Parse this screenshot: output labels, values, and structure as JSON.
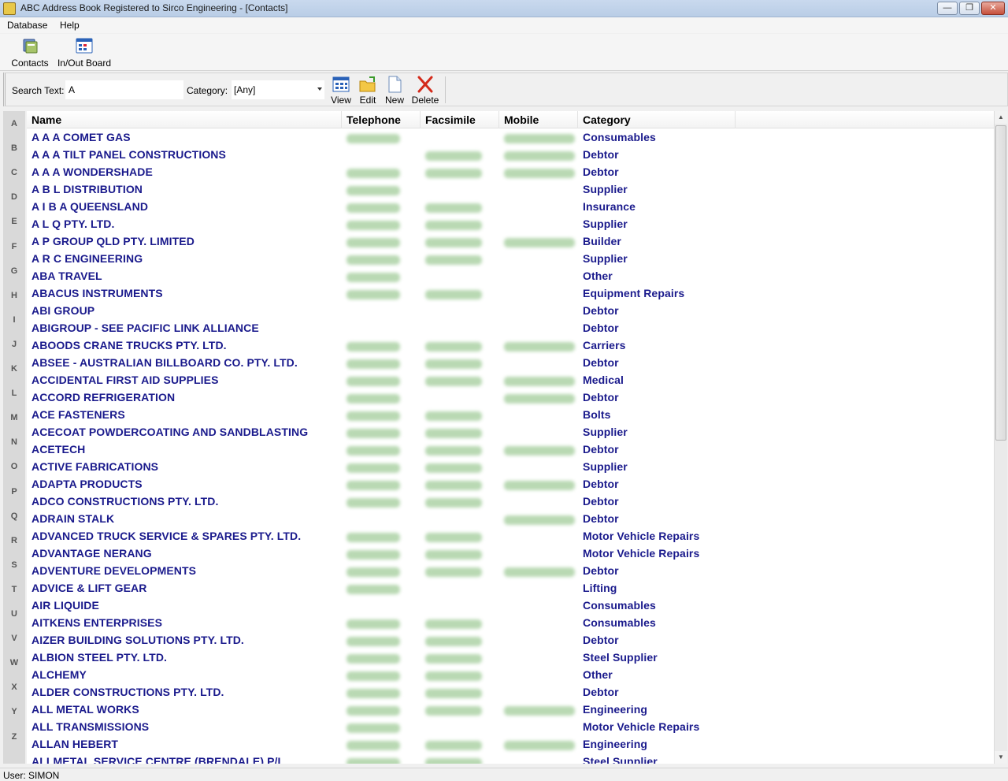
{
  "window": {
    "title": "ABC Address Book  Registered to Sirco Engineering - [Contacts]",
    "minimize_glyph": "—",
    "restore_glyph": "❐",
    "close_glyph": "✕"
  },
  "menu": {
    "items": [
      "Database",
      "Help"
    ]
  },
  "toolbar": {
    "contacts_label": "Contacts",
    "inout_label": "In/Out Board"
  },
  "search": {
    "search_label": "Search Text:",
    "search_value": "A",
    "category_label": "Category:",
    "category_value": "[Any]",
    "view_label": "View",
    "edit_label": "Edit",
    "new_label": "New",
    "delete_label": "Delete"
  },
  "alphabet": [
    "A",
    "B",
    "C",
    "D",
    "E",
    "F",
    "G",
    "H",
    "I",
    "J",
    "K",
    "L",
    "M",
    "N",
    "O",
    "P",
    "Q",
    "R",
    "S",
    "T",
    "U",
    "V",
    "W",
    "X",
    "Y",
    "Z"
  ],
  "table": {
    "columns": [
      "Name",
      "Telephone",
      "Facsimile",
      "Mobile",
      "Category"
    ],
    "rows": [
      {
        "name": "A A A COMET GAS",
        "category": "Consumables",
        "tel": 1,
        "fax": 0,
        "mob": 1
      },
      {
        "name": "A A A TILT PANEL CONSTRUCTIONS",
        "category": "Debtor",
        "tel": 0,
        "fax": 1,
        "mob": 1
      },
      {
        "name": "A A A WONDERSHADE",
        "category": "Debtor",
        "tel": 1,
        "fax": 1,
        "mob": 1
      },
      {
        "name": "A B L DISTRIBUTION",
        "category": "Supplier",
        "tel": 1,
        "fax": 0,
        "mob": 0
      },
      {
        "name": "A I B A QUEENSLAND",
        "category": "Insurance",
        "tel": 1,
        "fax": 1,
        "mob": 0
      },
      {
        "name": "A L Q PTY. LTD.",
        "category": "Supplier",
        "tel": 1,
        "fax": 1,
        "mob": 0
      },
      {
        "name": "A P GROUP QLD PTY. LIMITED",
        "category": "Builder",
        "tel": 1,
        "fax": 1,
        "mob": 1
      },
      {
        "name": "A R C ENGINEERING",
        "category": "Supplier",
        "tel": 1,
        "fax": 1,
        "mob": 0
      },
      {
        "name": "ABA TRAVEL",
        "category": "Other",
        "tel": 1,
        "fax": 0,
        "mob": 0
      },
      {
        "name": "ABACUS INSTRUMENTS",
        "category": "Equipment Repairs",
        "tel": 1,
        "fax": 1,
        "mob": 0
      },
      {
        "name": "ABI GROUP",
        "category": "Debtor",
        "tel": 0,
        "fax": 0,
        "mob": 0
      },
      {
        "name": "ABIGROUP - SEE PACIFIC LINK ALLIANCE",
        "category": "Debtor",
        "tel": 0,
        "fax": 0,
        "mob": 0
      },
      {
        "name": "ABOODS CRANE TRUCKS PTY. LTD.",
        "category": "Carriers",
        "tel": 1,
        "fax": 1,
        "mob": 1
      },
      {
        "name": "ABSEE - AUSTRALIAN BILLBOARD CO. PTY. LTD.",
        "category": "Debtor",
        "tel": 1,
        "fax": 1,
        "mob": 0
      },
      {
        "name": "ACCIDENTAL FIRST AID SUPPLIES",
        "category": "Medical",
        "tel": 1,
        "fax": 1,
        "mob": 1
      },
      {
        "name": "ACCORD REFRIGERATION",
        "category": "Debtor",
        "tel": 1,
        "fax": 0,
        "mob": 1
      },
      {
        "name": "ACE FASTENERS",
        "category": "Bolts",
        "tel": 1,
        "fax": 1,
        "mob": 0
      },
      {
        "name": "ACECOAT POWDERCOATING AND SANDBLASTING",
        "category": "Supplier",
        "tel": 1,
        "fax": 1,
        "mob": 0
      },
      {
        "name": "ACETECH",
        "category": "Debtor",
        "tel": 1,
        "fax": 1,
        "mob": 1
      },
      {
        "name": "ACTIVE FABRICATIONS",
        "category": "Supplier",
        "tel": 1,
        "fax": 1,
        "mob": 0
      },
      {
        "name": "ADAPTA PRODUCTS",
        "category": "Debtor",
        "tel": 1,
        "fax": 1,
        "mob": 1
      },
      {
        "name": "ADCO CONSTRUCTIONS PTY. LTD.",
        "category": "Debtor",
        "tel": 1,
        "fax": 1,
        "mob": 0
      },
      {
        "name": "ADRAIN STALK",
        "category": "Debtor",
        "tel": 0,
        "fax": 0,
        "mob": 1
      },
      {
        "name": "ADVANCED TRUCK SERVICE & SPARES PTY. LTD.",
        "category": "Motor Vehicle Repairs",
        "tel": 1,
        "fax": 1,
        "mob": 0
      },
      {
        "name": "ADVANTAGE NERANG",
        "category": "Motor Vehicle Repairs",
        "tel": 1,
        "fax": 1,
        "mob": 0
      },
      {
        "name": "ADVENTURE DEVELOPMENTS",
        "category": "Debtor",
        "tel": 1,
        "fax": 1,
        "mob": 1
      },
      {
        "name": "ADVICE & LIFT GEAR",
        "category": "Lifting",
        "tel": 1,
        "fax": 0,
        "mob": 0
      },
      {
        "name": "AIR LIQUIDE",
        "category": "Consumables",
        "tel": 0,
        "fax": 0,
        "mob": 0
      },
      {
        "name": "AITKENS ENTERPRISES",
        "category": "Consumables",
        "tel": 1,
        "fax": 1,
        "mob": 0
      },
      {
        "name": "AIZER BUILDING SOLUTIONS PTY. LTD.",
        "category": "Debtor",
        "tel": 1,
        "fax": 1,
        "mob": 0
      },
      {
        "name": "ALBION STEEL PTY. LTD.",
        "category": "Steel Supplier",
        "tel": 1,
        "fax": 1,
        "mob": 0
      },
      {
        "name": "ALCHEMY",
        "category": "Other",
        "tel": 1,
        "fax": 1,
        "mob": 0
      },
      {
        "name": "ALDER CONSTRUCTIONS PTY. LTD.",
        "category": "Debtor",
        "tel": 1,
        "fax": 1,
        "mob": 0
      },
      {
        "name": "ALL METAL WORKS",
        "category": "Engineering",
        "tel": 1,
        "fax": 1,
        "mob": 1
      },
      {
        "name": "ALL TRANSMISSIONS",
        "category": "Motor Vehicle Repairs",
        "tel": 1,
        "fax": 0,
        "mob": 0
      },
      {
        "name": "ALLAN HEBERT",
        "category": "Engineering",
        "tel": 1,
        "fax": 1,
        "mob": 1
      },
      {
        "name": "ALLMETAL SERVICE CENTRE (BRENDALE) P/L",
        "category": "Steel Supplier",
        "tel": 1,
        "fax": 1,
        "mob": 0
      }
    ]
  },
  "status": {
    "user": "User: SIMON"
  },
  "colors": {
    "text_blue": "#1a1a8c",
    "blur_green": "#b9d9b3"
  }
}
